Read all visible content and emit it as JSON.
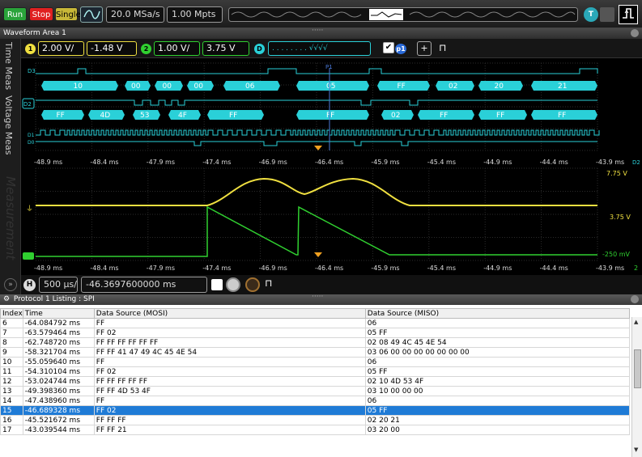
{
  "toolbar": {
    "run": "Run",
    "stop": "Stop",
    "single": "Single",
    "sample_rate": "20.0 MSa/s",
    "memory_depth": "1.00 Mpts",
    "trigger_badge": "T",
    "auto_icon": "auto-scale-icon",
    "trigger_icon": "trigger-edge-icon"
  },
  "waveform_area": {
    "title": "Waveform Area 1",
    "side_tabs": [
      "Time Meas",
      "Voltage Meas",
      "Measurement"
    ],
    "ch1": {
      "badge": "1",
      "scale": "2.00 V/",
      "offset": "-1.48 V",
      "color": "#f0e040"
    },
    "ch2": {
      "badge": "2",
      "scale": "1.00 V/",
      "offset": "3.75 V",
      "color": "#30d030"
    },
    "digital": {
      "badge": "D",
      "bits": ". . . . . . . . √√√√",
      "p1_label": "p1"
    },
    "plus_button": "+",
    "small_icon": "⊓"
  },
  "digital_traces": {
    "labels": [
      "D3",
      "D2",
      "D1",
      "D0"
    ],
    "bus_top": [
      "10",
      "00",
      "00",
      "00",
      "06",
      "05",
      "FF",
      "02",
      "20",
      "21"
    ],
    "bus_bottom": [
      "FF",
      "4D",
      "53",
      "4F",
      "FF",
      "FF",
      "02",
      "FF",
      "FF",
      "FF"
    ],
    "cursor_label": "P1",
    "right_label": "D2",
    "bus_color": "#2ad0d8"
  },
  "time_axis": [
    "-48.9 ms",
    "-48.4 ms",
    "-47.9 ms",
    "-47.4 ms",
    "-46.9 ms",
    "-46.4 ms",
    "-45.9 ms",
    "-45.4 ms",
    "-44.9 ms",
    "-44.4 ms",
    "-43.9 ms"
  ],
  "analog": {
    "top_label": "7.75 V",
    "mid_label": "3.75 V",
    "bottom_label": "-250 mV",
    "right_index": "2"
  },
  "horizontal": {
    "badge": "H",
    "timebase": "500 µs/",
    "position": "-46.3697600000 ms"
  },
  "listing": {
    "title": "Protocol 1 Listing : SPI",
    "columns": [
      "Index",
      "Time",
      "Data Source (MOSI)",
      "Data Source (MISO)"
    ],
    "rows": [
      [
        "6",
        "-64.084792 ms",
        "FF",
        "06"
      ],
      [
        "7",
        "-63.579464 ms",
        "FF 02",
        "05 FF"
      ],
      [
        "8",
        "-62.748720 ms",
        "FF FF FF FF FF FF",
        "02 08 49 4C 45 4E 54"
      ],
      [
        "9",
        "-58.321704 ms",
        "FF FF 41 47 49 4C 45 4E 54",
        "03 06 00 00 00 00 00 00 00"
      ],
      [
        "10",
        "-55.059640 ms",
        "FF",
        "06"
      ],
      [
        "11",
        "-54.310104 ms",
        "FF 02",
        "05 FF"
      ],
      [
        "12",
        "-53.024744 ms",
        "FF FF FF FF FF",
        "02 10 4D 53 4F"
      ],
      [
        "13",
        "-49.398360 ms",
        "FF FF 4D 53 4F",
        "03 10 00 00 00"
      ],
      [
        "14",
        "-47.438960 ms",
        "FF",
        "06"
      ],
      [
        "15",
        "-46.689328 ms",
        "FF 02",
        "05 FF"
      ],
      [
        "16",
        "-45.521672 ms",
        "FF FF FF",
        "02 20 21"
      ],
      [
        "17",
        "-43.039544 ms",
        "FF FF 21",
        "03 20 00"
      ]
    ],
    "selected_index": "15"
  }
}
